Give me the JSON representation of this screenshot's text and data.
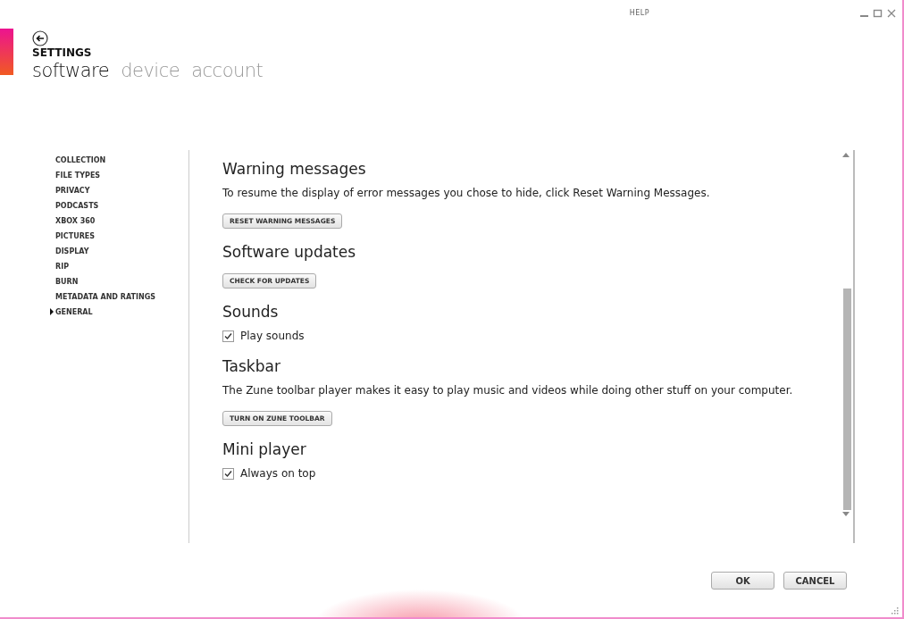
{
  "window": {
    "help": "HELP"
  },
  "header": {
    "title": "SETTINGS",
    "tabs": [
      {
        "label": "software",
        "selected": true
      },
      {
        "label": "device",
        "selected": false
      },
      {
        "label": "account",
        "selected": false
      }
    ]
  },
  "sidebar": {
    "items": [
      {
        "label": "COLLECTION",
        "selected": false
      },
      {
        "label": "FILE TYPES",
        "selected": false
      },
      {
        "label": "PRIVACY",
        "selected": false
      },
      {
        "label": "PODCASTS",
        "selected": false
      },
      {
        "label": "XBOX 360",
        "selected": false
      },
      {
        "label": "PICTURES",
        "selected": false
      },
      {
        "label": "DISPLAY",
        "selected": false
      },
      {
        "label": "RIP",
        "selected": false
      },
      {
        "label": "BURN",
        "selected": false
      },
      {
        "label": "METADATA AND RATINGS",
        "selected": false
      },
      {
        "label": "GENERAL",
        "selected": true
      }
    ]
  },
  "sections": [
    {
      "heading": "Warning messages",
      "items": [
        {
          "kind": "text",
          "text": "To resume the display of error messages you chose to hide, click Reset Warning Messages."
        },
        {
          "kind": "button",
          "label": "RESET WARNING MESSAGES"
        }
      ]
    },
    {
      "heading": "Software updates",
      "items": [
        {
          "kind": "button",
          "label": "CHECK FOR UPDATES"
        }
      ]
    },
    {
      "heading": "Sounds",
      "items": [
        {
          "kind": "checkbox",
          "label": "Play sounds",
          "checked": true
        }
      ]
    },
    {
      "heading": "Taskbar",
      "items": [
        {
          "kind": "text",
          "text": "The Zune toolbar player makes it easy to play music and videos while doing other stuff on your computer."
        },
        {
          "kind": "button",
          "label": "TURN ON ZUNE TOOLBAR"
        }
      ]
    },
    {
      "heading": "Mini player",
      "items": [
        {
          "kind": "checkbox",
          "label": "Always on top",
          "checked": true
        }
      ]
    }
  ],
  "footer": {
    "buttons": [
      "OK",
      "CANCEL"
    ]
  }
}
